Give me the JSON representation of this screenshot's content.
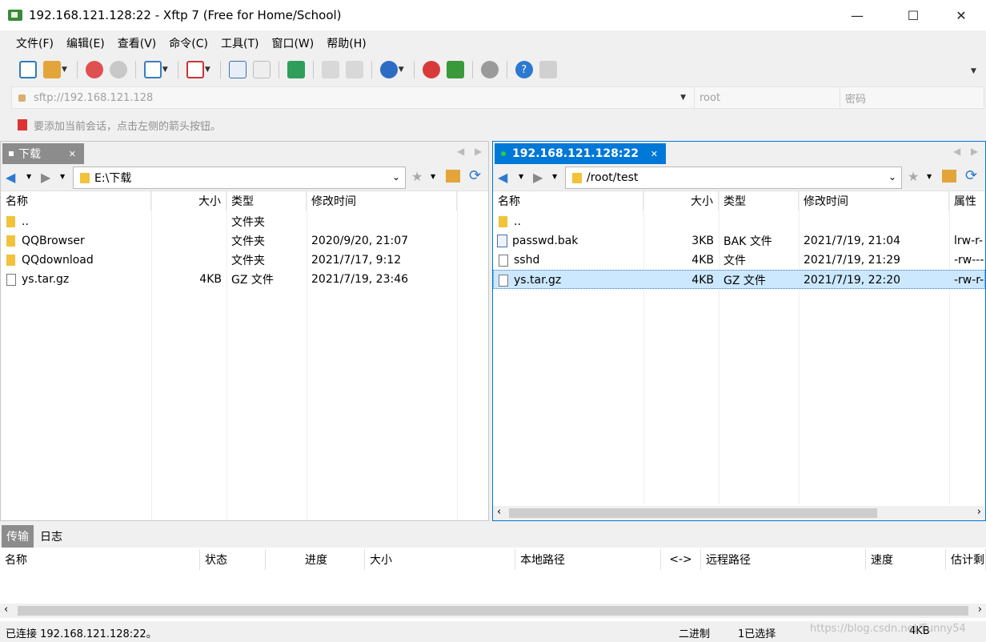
{
  "window": {
    "title": "192.168.121.128:22 - Xftp 7 (Free for Home/School)",
    "minimize_glyph": "—",
    "maximize_glyph": "☐",
    "close_glyph": "✕"
  },
  "menu": [
    "文件(F)",
    "编辑(E)",
    "查看(V)",
    "命令(C)",
    "工具(T)",
    "窗口(W)",
    "帮助(H)"
  ],
  "toolbar_icons": [
    "new-session-icon",
    "open-folder-icon",
    "disconnect-icon",
    "reconnect-icon",
    "session-manager-icon",
    "media-icon",
    "upload-icon",
    "download-icon",
    "sync-icon",
    "copy-icon",
    "paste-icon",
    "globe-icon",
    "xshell-icon",
    "xftp-icon",
    "settings-icon",
    "help-icon",
    "chat-icon"
  ],
  "address": {
    "url_placeholder": "sftp://192.168.121.128",
    "user_placeholder": "root",
    "password_placeholder": "密码"
  },
  "hint": "要添加当前会话，点击左侧的箭头按钮。",
  "left": {
    "tab": "下载",
    "path": "E:\\下载",
    "columns": [
      "名称",
      "大小",
      "类型",
      "修改时间"
    ],
    "rows": [
      {
        "name": "..",
        "size": "",
        "type": "文件夹",
        "modified": "",
        "icon": "folder"
      },
      {
        "name": "QQBrowser",
        "size": "",
        "type": "文件夹",
        "modified": "2020/9/20, 21:07",
        "icon": "folder"
      },
      {
        "name": "QQdownload",
        "size": "",
        "type": "文件夹",
        "modified": "2021/7/17, 9:12",
        "icon": "folder"
      },
      {
        "name": "ys.tar.gz",
        "size": "4KB",
        "type": "GZ 文件",
        "modified": "2021/7/19, 23:46",
        "icon": "file"
      }
    ]
  },
  "right": {
    "tab": "192.168.121.128:22",
    "path": "/root/test",
    "columns": [
      "名称",
      "大小",
      "类型",
      "修改时间",
      "属性"
    ],
    "rows": [
      {
        "name": "..",
        "size": "",
        "type": "",
        "modified": "",
        "attr": "",
        "icon": "folder"
      },
      {
        "name": "passwd.bak",
        "size": "3KB",
        "type": "BAK 文件",
        "modified": "2021/7/19, 21:04",
        "attr": "lrw-r-",
        "icon": "link"
      },
      {
        "name": "sshd",
        "size": "4KB",
        "type": "文件",
        "modified": "2021/7/19, 21:29",
        "attr": "-rw---",
        "icon": "file"
      },
      {
        "name": "ys.tar.gz",
        "size": "4KB",
        "type": "GZ 文件",
        "modified": "2021/7/19, 22:20",
        "attr": "-rw-r-",
        "icon": "file",
        "selected": true
      }
    ]
  },
  "bottom": {
    "tabs": [
      "传输",
      "日志"
    ],
    "columns": [
      "名称",
      "状态",
      "进度",
      "大小",
      "本地路径",
      "<->",
      "远程路径",
      "速度",
      "估计剩"
    ]
  },
  "status": {
    "connected": "已连接 192.168.121.128:22。",
    "mode": "二进制",
    "selection": "1已选择",
    "size": "4KB",
    "watermark": "https://blog.csdn.net/Funny54"
  },
  "colors": {
    "accent": "#0078d7",
    "selected_row": "#cce8ff",
    "folder": "#f2c23a"
  }
}
